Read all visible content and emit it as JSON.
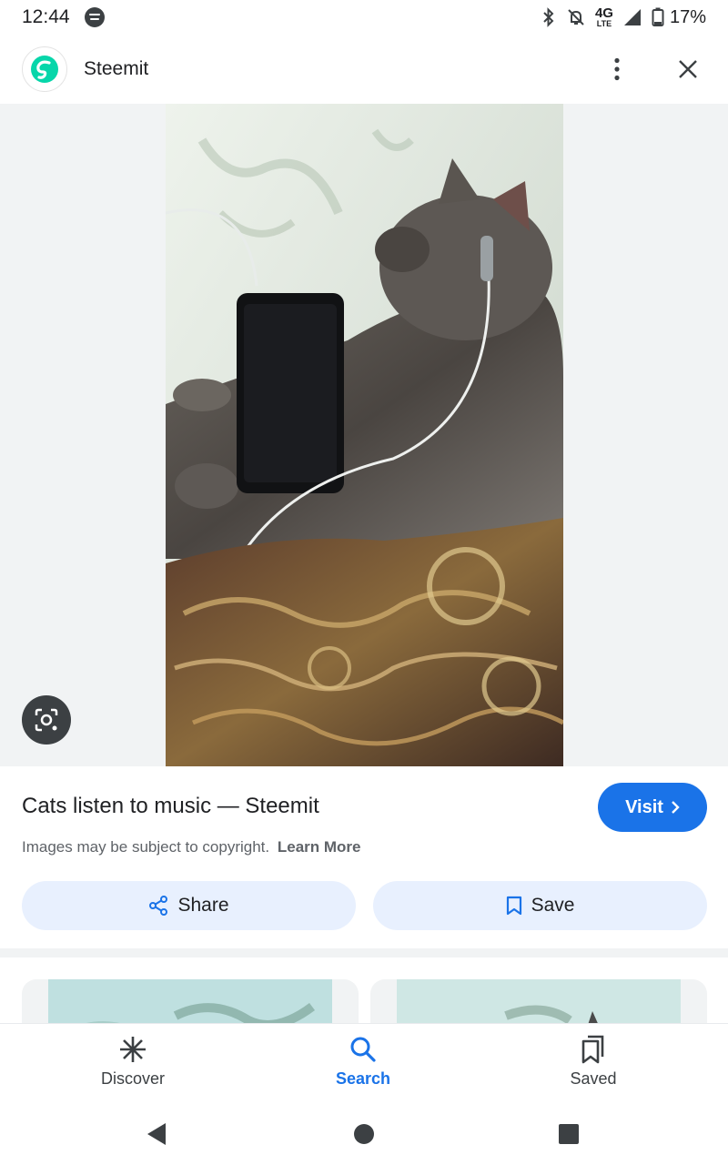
{
  "status_bar": {
    "time": "12:44",
    "network": "4G",
    "network_sub": "LTE",
    "battery": "17%"
  },
  "header": {
    "site_name": "Steemit",
    "logo_color": "#07d6aa"
  },
  "result": {
    "title": "Cats listen to music — Steemit",
    "visit_label": "Visit",
    "copyright_text": "Images may be subject to copyright.",
    "learn_more_label": "Learn More",
    "share_label": "Share",
    "save_label": "Save"
  },
  "bottom_nav": {
    "items": [
      {
        "label": "Discover",
        "icon": "asterisk-icon"
      },
      {
        "label": "Search",
        "icon": "search-icon",
        "selected": true
      },
      {
        "label": "Saved",
        "icon": "bookmarks-icon"
      }
    ]
  },
  "colors": {
    "accent": "#1a73e8",
    "tonal_button": "#e8f0fe",
    "stage_background": "#f1f3f4"
  }
}
